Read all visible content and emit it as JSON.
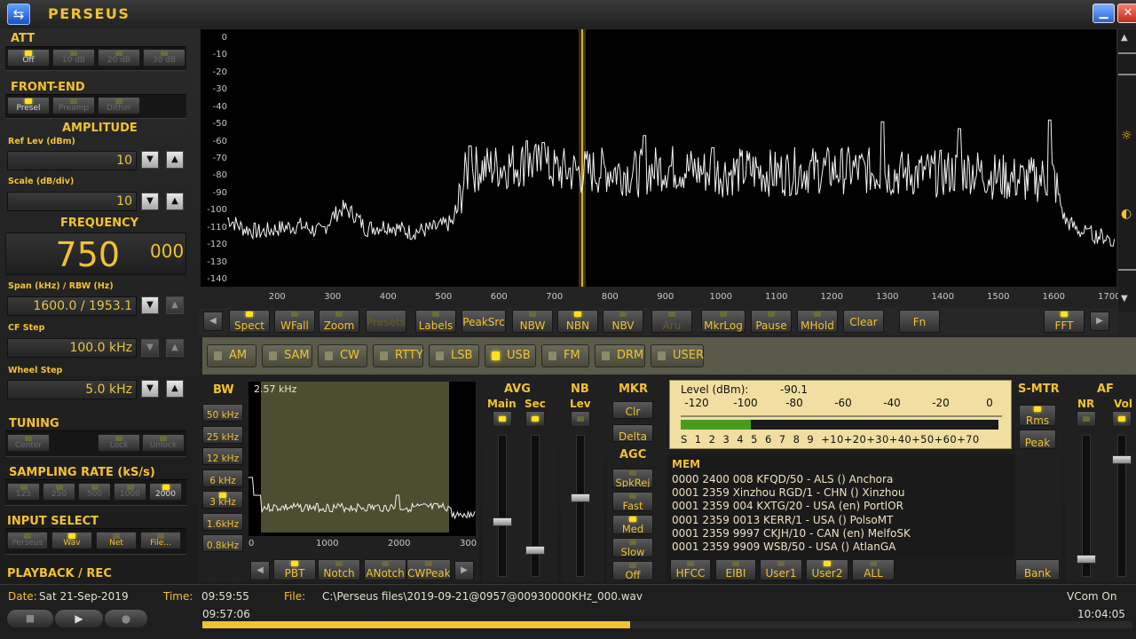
{
  "window": {
    "title": "PERSEUS",
    "minimize": "▁",
    "close": "✕"
  },
  "left": {
    "att": {
      "title": "ATT",
      "buttons": [
        "Off",
        "10 dB",
        "20 dB",
        "30 dB"
      ],
      "active": 0
    },
    "frontend": {
      "title": "FRONT-END",
      "buttons": [
        "Presel",
        "Preamp",
        "Dither"
      ],
      "active": [
        0
      ]
    },
    "amplitude": {
      "title": "AMPLITUDE",
      "ref_label": "Ref Lev (dBm)",
      "ref_value": "10",
      "scale_label": "Scale (dB/div)",
      "scale_value": "10"
    },
    "frequency": {
      "title": "FREQUENCY",
      "main": "750",
      "sub": "000",
      "span_label": "Span (kHz) / RBW (Hz)",
      "span_value": "1600.0 / 1953.1",
      "cf_label": "CF Step",
      "cf_value": "100.0 kHz",
      "wheel_label": "Wheel Step",
      "wheel_value": "5.0 kHz"
    },
    "tuning": {
      "title": "TUNING",
      "buttons": [
        "Center",
        "Lock",
        "Unlock"
      ]
    },
    "sampling": {
      "title": "SAMPLING RATE (kS/s)",
      "buttons": [
        "125",
        "250",
        "500",
        "1000",
        "2000"
      ],
      "active": 4
    },
    "input": {
      "title": "INPUT SELECT",
      "buttons": [
        "Perseus",
        "Wav",
        "Net",
        "File..."
      ],
      "active": 1
    },
    "playback": {
      "title": "PLAYBACK / REC"
    }
  },
  "spectrum": {
    "y_ticks": [
      "0",
      "-10",
      "-20",
      "-30",
      "-40",
      "-50",
      "-60",
      "-70",
      "-80",
      "-90",
      "-100",
      "-110",
      "-120",
      "-130",
      "-140"
    ],
    "x_ticks": [
      "200",
      "300",
      "400",
      "500",
      "600",
      "700",
      "800",
      "900",
      "1000",
      "1100",
      "1200",
      "1300",
      "1400",
      "1500",
      "1600",
      "1700"
    ],
    "ymin": -140,
    "ymax": 0,
    "xmin": 110,
    "xmax": 1710,
    "center_khz": 750,
    "trace_anchors": [
      [
        110,
        -104
      ],
      [
        140,
        -110
      ],
      [
        170,
        -112
      ],
      [
        200,
        -110
      ],
      [
        240,
        -108
      ],
      [
        280,
        -112
      ],
      [
        300,
        -103
      ],
      [
        320,
        -98
      ],
      [
        340,
        -102
      ],
      [
        360,
        -110
      ],
      [
        400,
        -108
      ],
      [
        440,
        -112
      ],
      [
        480,
        -110
      ],
      [
        520,
        -106
      ],
      [
        540,
        -78
      ],
      [
        560,
        -75
      ],
      [
        600,
        -74
      ],
      [
        650,
        -72
      ],
      [
        700,
        -76
      ],
      [
        750,
        -77
      ],
      [
        800,
        -76
      ],
      [
        850,
        -78
      ],
      [
        900,
        -74
      ],
      [
        950,
        -76
      ],
      [
        1000,
        -78
      ],
      [
        1050,
        -76
      ],
      [
        1100,
        -78
      ],
      [
        1150,
        -76
      ],
      [
        1200,
        -76
      ],
      [
        1250,
        -76
      ],
      [
        1300,
        -78
      ],
      [
        1350,
        -78
      ],
      [
        1400,
        -78
      ],
      [
        1450,
        -76
      ],
      [
        1500,
        -80
      ],
      [
        1550,
        -82
      ],
      [
        1600,
        -80
      ],
      [
        1620,
        -105
      ],
      [
        1650,
        -112
      ],
      [
        1680,
        -114
      ],
      [
        1710,
        -116
      ]
    ],
    "trace_peaks": [
      [
        548,
        -62
      ],
      [
        650,
        -59
      ],
      [
        680,
        -60
      ],
      [
        862,
        -56
      ],
      [
        985,
        -63
      ],
      [
        1292,
        -48
      ],
      [
        1430,
        -52
      ],
      [
        1593,
        -47
      ],
      [
        1662,
        -110
      ],
      [
        1705,
        -120
      ]
    ]
  },
  "toolbar": {
    "buttons": [
      {
        "label": "Spect",
        "led": "on"
      },
      {
        "label": "WFall",
        "led": "off"
      },
      {
        "label": "Zoom",
        "led": "off"
      },
      {
        "label": "Presets",
        "led": "none",
        "dim": true
      },
      {
        "label": "Labels",
        "led": "off"
      },
      {
        "label": "PeakSrc",
        "led": "none"
      },
      {
        "label": "NBW",
        "led": "off"
      },
      {
        "label": "NBN",
        "led": "on"
      },
      {
        "label": "NBV",
        "led": "off"
      },
      {
        "label": "Aru",
        "led": "off",
        "dim": true
      },
      {
        "label": "MkrLog",
        "led": "off"
      },
      {
        "label": "Pause",
        "led": "off"
      },
      {
        "label": "MHold",
        "led": "off"
      },
      {
        "label": "Clear",
        "led": "none"
      },
      {
        "label": "Fn",
        "led": "none"
      },
      {
        "label": "FFT",
        "led": "on"
      }
    ]
  },
  "modes": {
    "items": [
      "AM",
      "SAM",
      "CW",
      "RTTY",
      "LSB",
      "USB",
      "FM",
      "DRM",
      "USER"
    ],
    "active": 5
  },
  "bw": {
    "title": "BW",
    "readout": "2.57 kHz",
    "buttons": [
      "50 kHz",
      "25 kHz",
      "12 kHz",
      "6 kHz",
      "3 kHz",
      "1.6kHz",
      "0.8kHz"
    ],
    "active": 4,
    "x_ticks": [
      "0",
      "1000",
      "2000",
      "300"
    ],
    "bottom_buttons": [
      "PBT",
      "Notch",
      "ANotch",
      "CWPeak"
    ]
  },
  "avg": {
    "title": "AVG",
    "main": "Main",
    "sec": "Sec"
  },
  "nb": {
    "title": "NB",
    "lev": "Lev"
  },
  "mkr": {
    "title": "MKR",
    "clr": "Clr",
    "delta": "Delta"
  },
  "agc": {
    "title": "AGC",
    "buttons": [
      "SpkRej",
      "Fast",
      "Med",
      "Slow",
      "Off"
    ],
    "active": 2
  },
  "meter": {
    "level_label": "Level (dBm):",
    "level_value": "-90.1",
    "top_ticks": [
      "-120",
      "-100",
      "-80",
      "-60",
      "-40",
      "-20",
      "0"
    ],
    "s_labels": "S  1  2  3  4  5  6  7  8  9  +10+20+30+40+50+60+70",
    "fill_fraction": 0.22
  },
  "smtr": {
    "title": "S-MTR",
    "rms": "Rms",
    "peak": "Peak"
  },
  "af": {
    "title": "AF",
    "nr": "NR",
    "vol": "Vol"
  },
  "mem": {
    "title": "MEM",
    "rows": [
      "0000 2400 008 KFQD/50   - ALS ()   Anchora",
      "0001 2359 Xinzhou RGD/1   - CHN ()   Xinzhou",
      "0001 2359 004 KXTG/20   - USA (en)   PortlOR",
      "0001 2359 0013 KERR/1   - USA ()   PolsoMT",
      "0001 2359 9997 CKJH/10   - CAN (en)   MelfoSK",
      "0001 2359 9909 WSB/50   - USA ()   AtlanGA"
    ],
    "buttons": [
      "HFCC",
      "EIBI",
      "User1",
      "User2",
      "ALL",
      "Bank"
    ]
  },
  "status": {
    "date_label": "Date:",
    "date_value": "Sat 21-Sep-2019",
    "time_label": "Time:",
    "time_value": "09:59:55",
    "file_label": "File:",
    "file_value": "C:\\Perseus files\\2019-09-21@0957@00930000KHz_000.wav",
    "vcom": "VCom On",
    "start_time": "09:57:06",
    "end_time": "10:04:05",
    "progress": 0.46
  }
}
